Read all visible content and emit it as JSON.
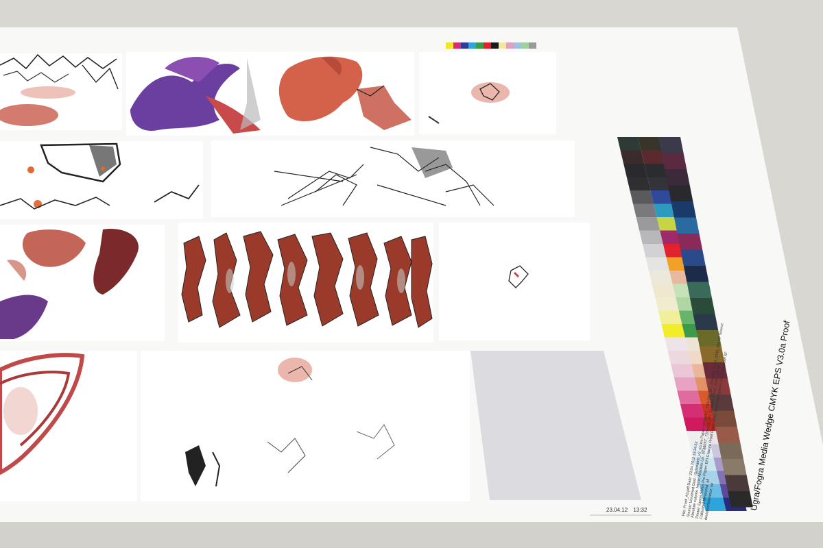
{
  "stamp": {
    "date": "23.04.12",
    "time": "13:32"
  },
  "wedge_title": "Ugra/Fogra Media Wedge CMYK EPS V3.0a Proof",
  "metadata_lines": [
    "File: Proof_A3.pdf  Date: 23.04.2012 13:34:52",
    "Source: Unnamed  Dest.: ISOcoated_v2_eci.icc  Paper: SF880XT_720x720_EFI_Gravure_Proof_4245_SM HP Source",
    "Absolute colorim.  Intent: Absolute  Lin: SF880XT_720x720_EFI_Gravure_Proof_4245_SM HP",
    "Printer: Epson Stylus Pro  Paper: EFI Gravure Proof Paper 4245 Semimatt  System: EFI Colorproof XF",
    "Calibrated  Measured: all",
    "deviation/tolerance: ok"
  ],
  "wedge_colors": {
    "left_column": [
      "#2e3a36",
      "#3a2c2c",
      "#2a2a2e",
      "#2f2f31",
      "#5a5a5c",
      "#7a7a7c",
      "#9a9a9c",
      "#b8b8ba",
      "#d2d2d4",
      "#e4e4e2",
      "#ece9dc",
      "#efe8cf",
      "#f0eccf",
      "#f2ef9a",
      "#f3ec2a",
      "#ede4ea",
      "#edd8e0",
      "#ebc6d6",
      "#e8a2c2",
      "#e06c9e",
      "#d42f74",
      "#cf1b5e",
      "#eeeeee",
      "#e3eef4",
      "#c9e3ef",
      "#a7d3ea",
      "#6bbde3",
      "#2ea4dc"
    ],
    "mid_column": [
      "#37352a",
      "#5a2a2f",
      "#2a2c30",
      "#34323a",
      "#2f4a9a",
      "#2d9bc0",
      "#c7d443",
      "#9e2a6c",
      "#e2232e",
      "#f1a12a",
      "#e8b99f",
      "#c7e1b8",
      "#b0d6a4",
      "#67b56d",
      "#3e9a4b",
      "#ece5d6",
      "#f0d9c6",
      "#eab79a",
      "#e29266",
      "#d85a2f",
      "#cd3223",
      "#c1241f",
      "#e8e4ea",
      "#ccc6df",
      "#a89bcb",
      "#8274b4",
      "#5a4a9c",
      "#2a2a7a"
    ],
    "right_column": [
      "#3a3a4a",
      "#5a2a40",
      "#3a2a3a",
      "#2a2a2e",
      "#1a3a6a",
      "#2a6aa0",
      "#8a2a5a",
      "#2a4a8a",
      "#1e2a4a",
      "#3a6a5a",
      "#2a4a3a",
      "#2a3a4a",
      "#6a6a2a",
      "#8a6a2a",
      "#6a2a3a",
      "#8a3a3a",
      "#5a3a3a",
      "#7a4a3a",
      "#9a5a4a",
      "#7a6a5a",
      "#8a7a6a",
      "#4a3a3a",
      "#2a2a2a"
    ],
    "top_strip": [
      "#f3e52a",
      "#d42f74",
      "#2e3f9a",
      "#2ea4dc",
      "#3e9a4b",
      "#e2232e",
      "#1a1a1a",
      "#f1e8a0",
      "#e0a0c0",
      "#a0c0e0",
      "#a0d0a0",
      "#9a9a9a"
    ]
  }
}
